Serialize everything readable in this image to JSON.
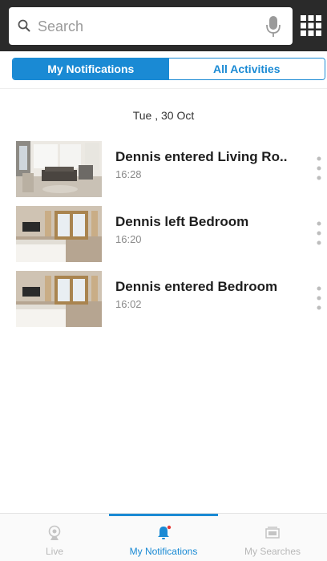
{
  "search": {
    "placeholder": "Search"
  },
  "tabs": [
    {
      "label": "My Notifications",
      "active": true
    },
    {
      "label": "All Activities",
      "active": false
    }
  ],
  "date_header": "Tue , 30 Oct",
  "notifications": [
    {
      "title": "Dennis entered Living Ro..",
      "time": "16:28",
      "room": "living-room"
    },
    {
      "title": "Dennis left Bedroom",
      "time": "16:20",
      "room": "bedroom"
    },
    {
      "title": "Dennis entered Bedroom",
      "time": "16:02",
      "room": "bedroom"
    }
  ],
  "bottom_nav": [
    {
      "label": "Live",
      "icon": "camera-icon",
      "active": false
    },
    {
      "label": "My Notifications",
      "icon": "bell-icon",
      "active": true
    },
    {
      "label": "My Searches",
      "icon": "search-history-icon",
      "active": false
    }
  ],
  "colors": {
    "accent": "#1a8ad4",
    "topbar": "#2a2a2a",
    "badge": "#e53935"
  }
}
